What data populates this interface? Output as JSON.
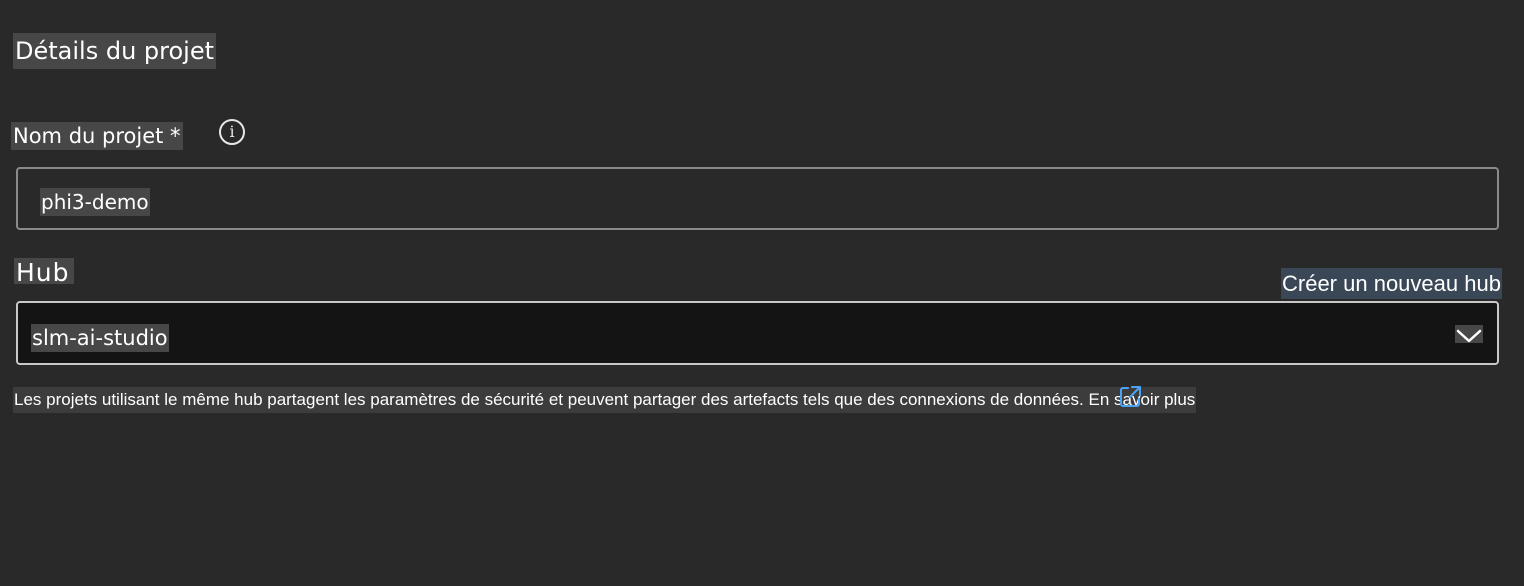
{
  "section": {
    "title": "Détails du projet"
  },
  "project_name": {
    "label": "Nom du projet *",
    "value": "phi3-demo",
    "info_icon": "info-icon"
  },
  "hub": {
    "label": "Hub",
    "create_link": "Créer un nouveau hub",
    "selected": "slm-ai-studio",
    "dropdown_icon": "chevron-down-icon",
    "helper_text": "Les projets utilisant le même hub partagent les paramètres de sécurité et peuvent partager des artefacts tels que des connexions de données.",
    "learn_more": "En savoir plus",
    "learn_more_icon": "external-link-icon"
  },
  "colors": {
    "background": "#292929",
    "link_highlight": "#3a4756",
    "select_background": "#141414",
    "external_link": "#4ba3f5"
  }
}
